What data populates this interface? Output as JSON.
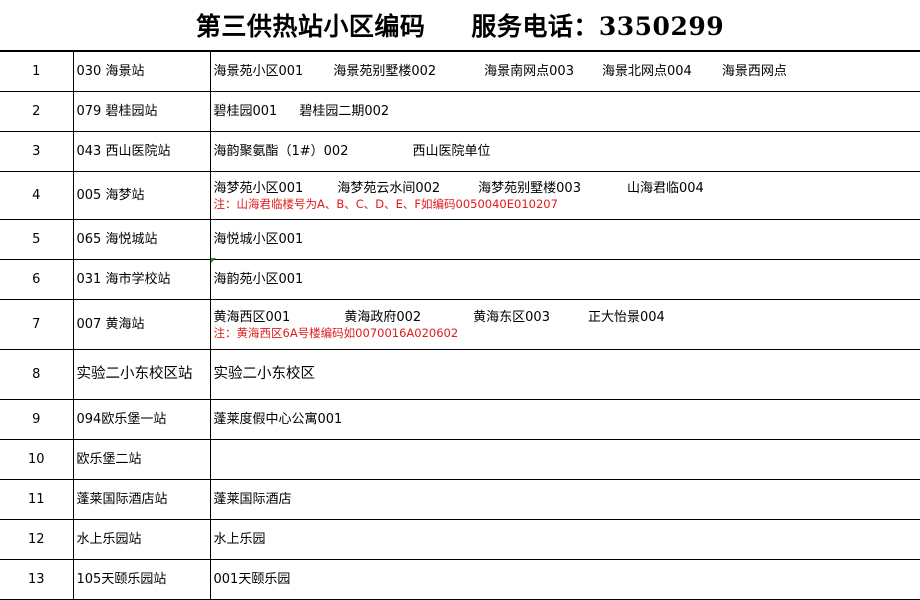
{
  "header": {
    "title": "第三供热站小区编码",
    "phone": "服务电话：3350299"
  },
  "rows": [
    {
      "no": "1",
      "station": "030  海景站",
      "areas": [
        "海景苑小区001",
        "海景苑别墅楼002",
        "海景南网点003",
        "海景北网点004",
        "海景西网点"
      ],
      "note": ""
    },
    {
      "no": "2",
      "station": "079  碧桂园站",
      "areas": [
        "碧桂园001",
        "碧桂园二期002"
      ],
      "note": ""
    },
    {
      "no": "3",
      "station": "043  西山医院站",
      "areas": [
        "海韵聚氨酯（1#）002",
        "西山医院单位"
      ],
      "note": ""
    },
    {
      "no": "4",
      "station": "005  海梦站",
      "areas": [
        "海梦苑小区001",
        "海梦苑云水间002",
        "海梦苑别墅楼003",
        "山海君临004"
      ],
      "note": "注：山海君临楼号为A、B、C、D、E、F如编码0050040E010207"
    },
    {
      "no": "5",
      "station": "065  海悦城站",
      "areas": [
        "海悦城小区001"
      ],
      "note": ""
    },
    {
      "no": "6",
      "station": "031  海市学校站",
      "areas": [
        "海韵苑小区001"
      ],
      "note": ""
    },
    {
      "no": "7",
      "station": "007  黄海站",
      "areas": [
        "黄海西区001",
        "黄海政府002",
        "黄海东区003",
        "正大怡景004"
      ],
      "note": "注：黄海西区6A号楼编码如0070016A020602"
    },
    {
      "no": "8",
      "station": "实验二小东校区站",
      "areas": [
        "实验二小东校区"
      ],
      "note": ""
    },
    {
      "no": "9",
      "station": "094欧乐堡一站",
      "areas": [
        "蓬莱度假中心公寓001"
      ],
      "note": ""
    },
    {
      "no": "10",
      "station": "欧乐堡二站",
      "areas": [],
      "note": ""
    },
    {
      "no": "11",
      "station": "蓬莱国际酒店站",
      "areas": [
        "蓬莱国际酒店"
      ],
      "note": ""
    },
    {
      "no": "12",
      "station": "水上乐园站",
      "areas": [
        "水上乐园"
      ],
      "note": ""
    },
    {
      "no": "13",
      "station": "105天颐乐园站",
      "areas": [
        "001天颐乐园"
      ],
      "note": ""
    }
  ],
  "colors": {
    "note": "#e01b1b",
    "grid": "#000000",
    "comment_marker": "#1f8a2e"
  }
}
